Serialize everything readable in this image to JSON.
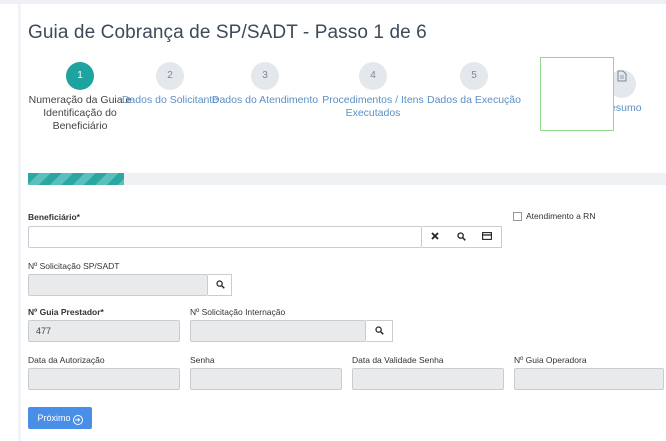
{
  "page": {
    "title": "Guia de Cobrança de SP/SADT - Passo 1 de 6"
  },
  "steps": [
    {
      "number": "1",
      "label": "Numeração da Guia e Identificação do Beneficiário",
      "active": true
    },
    {
      "number": "2",
      "label": "Dados do Solicitante",
      "active": false
    },
    {
      "number": "3",
      "label": "Dados do Atendimento",
      "active": false
    },
    {
      "number": "4",
      "label": "Procedimentos / Itens Executados",
      "active": false
    },
    {
      "number": "5",
      "label": "Dados da Execução",
      "active": false
    },
    {
      "number": "",
      "label": "Resumo",
      "icon": "document-icon",
      "active": false
    }
  ],
  "progress": {
    "fraction": 0.15,
    "color": "#2aa6a3"
  },
  "form": {
    "beneficiario": {
      "label": "Beneficiário*",
      "value": ""
    },
    "atendimento_rn": {
      "label": "Atendimento a RN",
      "checked": false
    },
    "solicitacao_spsadt": {
      "label": "Nº Solicitação SP/SADT",
      "value": ""
    },
    "guia_prestador": {
      "label": "Nº Guia Prestador*",
      "value": "477"
    },
    "solicitacao_internacao": {
      "label": "Nº Solicitação Internação",
      "value": ""
    },
    "data_autorizacao": {
      "label": "Data da Autorização",
      "value": ""
    },
    "senha": {
      "label": "Senha",
      "value": ""
    },
    "data_validade_senha": {
      "label": "Data da Validade Senha",
      "value": ""
    },
    "guia_operadora": {
      "label": "Nº Guia Operadora",
      "value": ""
    }
  },
  "buttons": {
    "next": "Próximo"
  },
  "icons": {
    "clear": "close-icon",
    "search": "search-icon",
    "card": "card-icon"
  },
  "colors": {
    "accent": "#1fa3a0",
    "link": "#5b8fc4",
    "primary_button": "#4a8fe7",
    "highlight_box": "#8fd98a"
  }
}
